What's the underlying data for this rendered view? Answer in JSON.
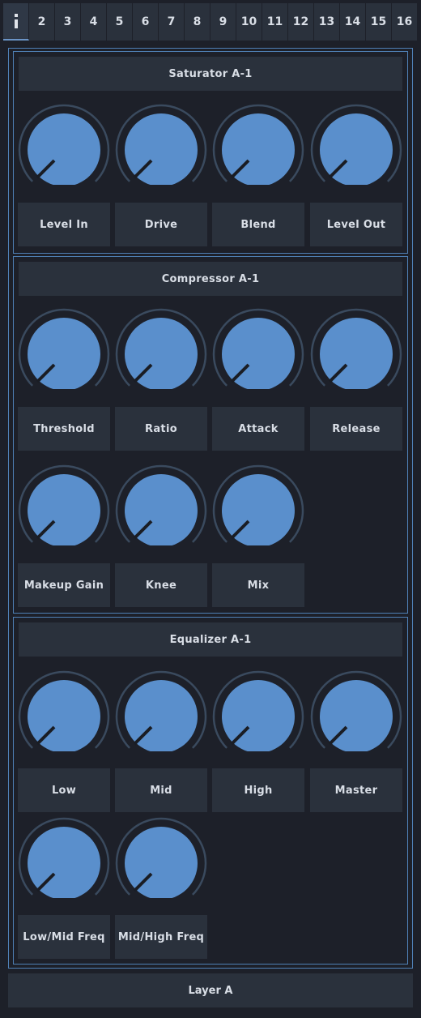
{
  "tabs": {
    "active": "info-icon",
    "numbers": [
      "2",
      "3",
      "4",
      "5",
      "6",
      "7",
      "8",
      "9",
      "10",
      "11",
      "12",
      "13",
      "14",
      "15",
      "16"
    ]
  },
  "colors": {
    "accent": "#4f80b5",
    "knob_fill": "#5a8fcc",
    "knob_ring": "#3a4a5e",
    "panel_bg": "#2a313c",
    "background": "#1d2029"
  },
  "saturator": {
    "title": "Saturator A-1",
    "params": [
      "Level In",
      "Drive",
      "Blend",
      "Level Out"
    ]
  },
  "compressor": {
    "title": "Compressor A-1",
    "params": [
      "Threshold",
      "Ratio",
      "Attack",
      "Release",
      "Makeup Gain",
      "Knee",
      "Mix"
    ]
  },
  "equalizer": {
    "title": "Equalizer A-1",
    "params": [
      "Low",
      "Mid",
      "High",
      "Master",
      "Low/Mid Freq",
      "Mid/High Freq"
    ]
  },
  "footer": {
    "layer_label": "Layer A"
  }
}
